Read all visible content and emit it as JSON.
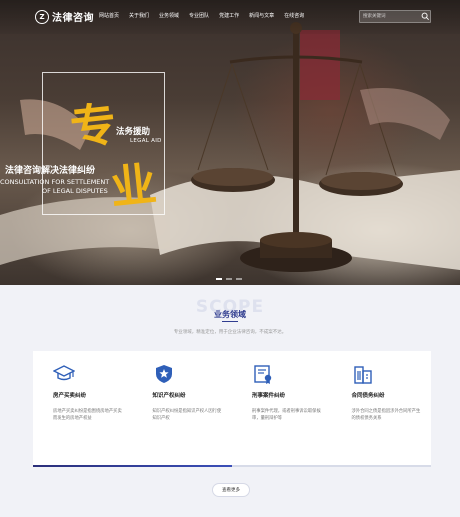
{
  "header": {
    "logo_mark": "Z",
    "logo_text": "法律咨询",
    "nav": [
      "网站首页",
      "关于我们",
      "业务领域",
      "专业团队",
      "党建工作",
      "新闻与文章",
      "在线咨询"
    ],
    "search_placeholder": "搜索关键词"
  },
  "hero": {
    "big_char_1": "专",
    "big_char_2": "业",
    "legal_aid_cn": "法务援助",
    "legal_aid_en": "LEGAL AID",
    "consult_cn": "法律咨询解决法律纠纷",
    "consult_en_line1": "CONSULTATION FOR SETTLEMENT",
    "consult_en_line2": "OF LEGAL DISPUTES",
    "slides": 3,
    "active_slide": 0
  },
  "scope": {
    "watermark": "SCOPE",
    "title": "业务领域",
    "subtitle": "专业领域，精准定位，用于企业法律咨询，不成案不达。",
    "cards": [
      {
        "icon": "graduation-cap-icon",
        "title": "房产买卖纠纷",
        "desc": "房地产买卖纠纷是指围绕房地产买卖而发生的房地产权益"
      },
      {
        "icon": "star-badge-icon",
        "title": "知识产权纠纷",
        "desc": "知识产权纠纷是指知识产权人因行使知识产权"
      },
      {
        "icon": "certificate-icon",
        "title": "刑事案件纠纷",
        "desc": "刑事案件代理，或者刑事诉讼取保候审，量刑辩护等"
      },
      {
        "icon": "building-icon",
        "title": "合同债务纠纷",
        "desc": "涉外合同之债是指因涉外合同所产生的债权债务关系"
      }
    ],
    "more_label": "查看更多"
  },
  "colors": {
    "accent": "#2f3c8f",
    "gold": "#f0b417",
    "background": "#f1f2f7"
  }
}
